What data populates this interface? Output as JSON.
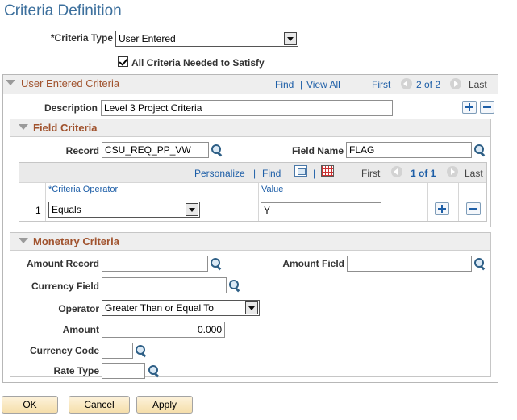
{
  "page": {
    "title": "Criteria Definition"
  },
  "criteria_type": {
    "label": "*Criteria Type",
    "value": "User Entered"
  },
  "all_criteria": {
    "label": "All Criteria Needed to Satisfy",
    "checked": true
  },
  "user_entered": {
    "title": "User Entered Criteria",
    "find_label": "Find",
    "view_all_label": "View All",
    "first_label": "First",
    "range_text": "2 of 2",
    "last_label": "Last",
    "description_label": "Description",
    "description_value": "Level 3 Project Criteria"
  },
  "field_criteria": {
    "title": "Field Criteria",
    "record_label": "Record",
    "record_value": "CSU_REQ_PP_VW",
    "field_name_label": "Field Name",
    "field_name_value": "FLAG",
    "grid": {
      "personalize_label": "Personalize",
      "find_label": "Find",
      "first_label": "First",
      "range_text": "1 of 1",
      "last_label": "Last",
      "col_operator": "*Criteria Operator",
      "col_value": "Value",
      "rows": [
        {
          "num": "1",
          "operator": "Equals",
          "value": "Y"
        }
      ]
    }
  },
  "monetary_criteria": {
    "title": "Monetary Criteria",
    "amount_record_label": "Amount Record",
    "amount_record_value": "",
    "amount_field_label": "Amount Field",
    "amount_field_value": "",
    "currency_field_label": "Currency Field",
    "currency_field_value": "",
    "operator_label": "Operator",
    "operator_value": "Greater Than or Equal To",
    "amount_label": "Amount",
    "amount_value": "0.000",
    "currency_code_label": "Currency Code",
    "currency_code_value": "",
    "rate_type_label": "Rate Type",
    "rate_type_value": ""
  },
  "buttons": {
    "ok": "OK",
    "cancel": "Cancel",
    "apply": "Apply"
  },
  "colors": {
    "title": "#3c6f9c",
    "section_title": "#a0522d",
    "link": "#1d5ea7"
  }
}
